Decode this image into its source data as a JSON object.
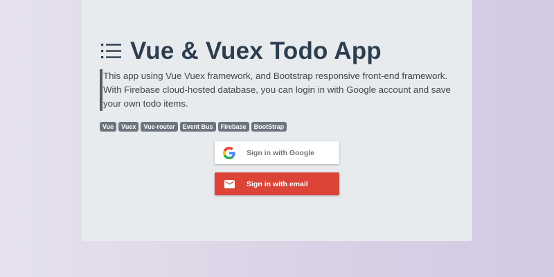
{
  "header": {
    "title": "Vue & Vuex Todo App",
    "icon": "list-icon"
  },
  "description": {
    "lines": [
      "This app using Vue Vuex framework, and Bootstrap responsive front-end framework.",
      "With Firebase cloud-hosted database, you can login in with Google account and save",
      "your own todo items."
    ]
  },
  "tags": [
    "Vue",
    "Vuex",
    "Vue-router",
    "Event Bus",
    "Firebase",
    "BootStrap"
  ],
  "auth": {
    "google_label": "Sign in with Google",
    "email_label": "Sign in with email",
    "google_icon": "google-logo-icon",
    "email_icon": "mail-icon"
  },
  "colors": {
    "title": "#2c3e50",
    "tag_bg": "#6c757d",
    "email_button": "#db4437",
    "card_bg": "#e8ebee"
  }
}
